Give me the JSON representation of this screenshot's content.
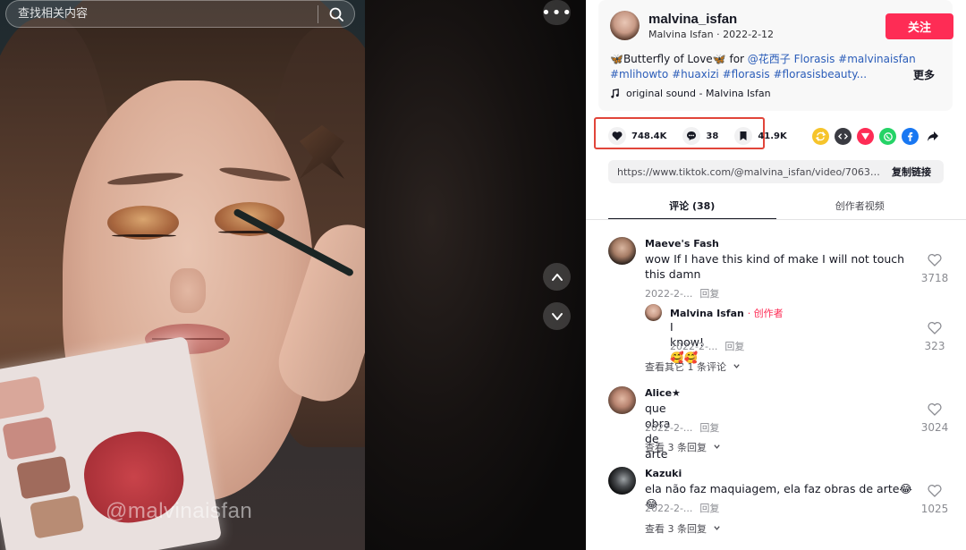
{
  "search": {
    "placeholder": "查找相关内容"
  },
  "video": {
    "watermark": "@malvinaisfan"
  },
  "author": {
    "username": "malvina_isfan",
    "display_name": "Malvina Isfan",
    "date": "2022-2-12",
    "follow_label": "关注"
  },
  "description": {
    "emoji": "🦋",
    "text_plain": "Butterfly of Love",
    "for_word": "for",
    "mention": "@花西子",
    "tags_line1": [
      "Florasis",
      "#malvinaisfan"
    ],
    "tags_line2": [
      "#mlihowto",
      "#huaxizi",
      "#florasis",
      "#florasisbeauty..."
    ],
    "more_label": "更多"
  },
  "sound": {
    "label": "original sound - Malvina Isfan"
  },
  "stats": {
    "likes": "748.4K",
    "comments": "38",
    "saves": "41.9K"
  },
  "share_icons": [
    "repost-icon",
    "embed-icon",
    "send-icon",
    "whatsapp-icon",
    "facebook-icon",
    "share-arrow-icon"
  ],
  "link": {
    "url": "https://www.tiktok.com/@malvina_isfan/video/706382...",
    "copy_label": "复制链接"
  },
  "tabs": [
    {
      "label": "评论 (38)",
      "active": true
    },
    {
      "label": "创作者视频",
      "active": false
    }
  ],
  "comments": [
    {
      "name": "Maeve's Fash",
      "text": "wow If I have this kind of make I will not touch this damn",
      "date": "2022-2-...",
      "reply_label": "回复",
      "likes": "3718"
    },
    {
      "name": "Malvina Isfan",
      "creator_label": "· 创作者",
      "text": "I know!🥰🥰",
      "date": "2022-2-...",
      "reply_label": "回复",
      "likes": "323"
    },
    {
      "name": "Alice★",
      "text": "que obra de arte",
      "date": "2022-2-...",
      "reply_label": "回复",
      "likes": "3024"
    },
    {
      "name": "Kazuki",
      "text": "ela não faz maquiagem, ela faz obras de arte😂😂",
      "date": "2022-2-...",
      "reply_label": "回复",
      "likes": "1025"
    }
  ],
  "view_more": [
    "查看其它 1 条评论",
    "查看 3 条回复",
    "查看 3 条回复"
  ],
  "colors": {
    "accent": "#fe2c55",
    "tag": "#2b5db9",
    "highlight_box": "#e1453a"
  }
}
